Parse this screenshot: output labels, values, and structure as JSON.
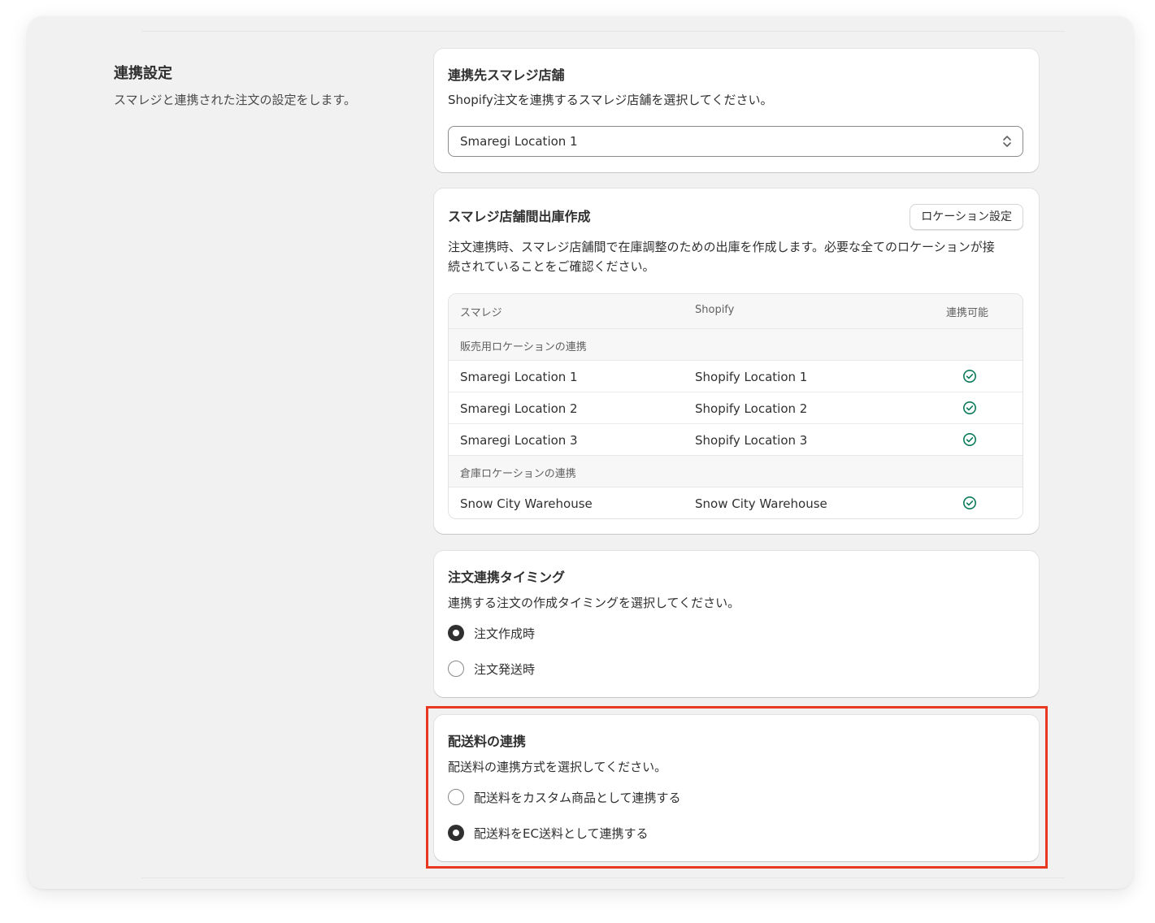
{
  "section": {
    "title": "連携設定",
    "description": "スマレジと連携された注文の設定をします。"
  },
  "store_card": {
    "title": "連携先スマレジ店舗",
    "description": "Shopify注文を連携するスマレジ店舗を選択してください。",
    "select_value": "Smaregi Location 1"
  },
  "transfer_card": {
    "title": "スマレジ店舗間出庫作成",
    "button_label": "ロケーション設定",
    "description_line1": "注文連携時、スマレジ店舗間で在庫調整のための出庫を作成します。必要な全てのロケーションが接",
    "description_line2": "続されていることをご確認ください。",
    "table": {
      "headers": [
        "スマレジ",
        "Shopify",
        "連携可能"
      ],
      "groups": [
        {
          "label": "販売用ロケーションの連携",
          "rows": [
            {
              "smaregi": "Smaregi Location 1",
              "shopify": "Shopify Location 1",
              "status": "check-circle-icon"
            },
            {
              "smaregi": "Smaregi Location 2",
              "shopify": "Shopify Location 2",
              "status": "check-circle-icon"
            },
            {
              "smaregi": "Smaregi Location 3",
              "shopify": "Shopify Location 3",
              "status": "check-circle-icon"
            }
          ]
        },
        {
          "label": "倉庫ロケーションの連携",
          "rows": [
            {
              "smaregi": "Snow City Warehouse",
              "shopify": "Snow City Warehouse",
              "status": "check-circle-icon"
            }
          ]
        }
      ]
    }
  },
  "timing_card": {
    "title": "注文連携タイミング",
    "description": "連携する注文の作成タイミングを選択してください。",
    "options": [
      {
        "label": "注文作成時",
        "selected": true
      },
      {
        "label": "注文発送時",
        "selected": false
      }
    ]
  },
  "shipping_card": {
    "title": "配送料の連携",
    "description": "配送料の連携方式を選択してください。",
    "options": [
      {
        "label": "配送料をカスタム商品として連携する",
        "selected": false
      },
      {
        "label": "配送料をEC送料として連携する",
        "selected": true
      }
    ]
  },
  "colors": {
    "page_bg": "#f1f1f1",
    "card_bg": "#ffffff",
    "check_green": "#0c7a5a",
    "highlight_red": "#e8381f",
    "text": "#303030"
  }
}
